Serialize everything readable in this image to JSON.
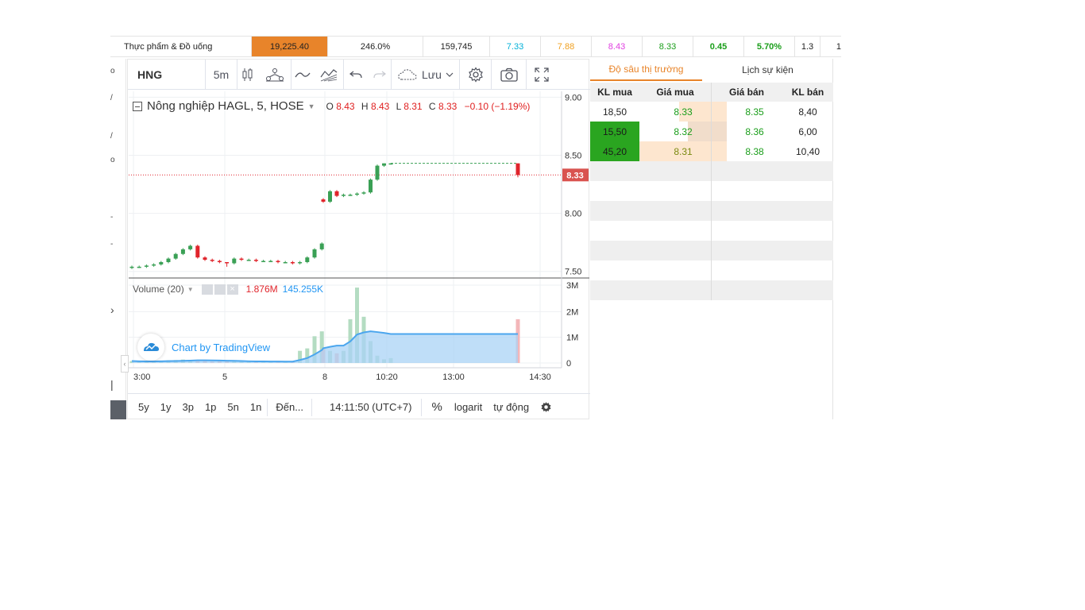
{
  "ticker": {
    "name": "Thực phẩm & Đồ uống",
    "value": "19,225.40",
    "pct": "246.0%",
    "volume": "159,745",
    "c1": "7.33",
    "c2": "7.88",
    "c3": "8.43",
    "c4": "8.33",
    "c5": "0.45",
    "c6": "5.70%",
    "c7": "1.3",
    "c8": "1",
    "colors": {
      "orange": "#e8842a",
      "cyan": "#00b0d8",
      "yellow": "#f0a020",
      "magenta": "#e040e0",
      "green": "#1a9e1a"
    }
  },
  "left_strip": {
    "glyphs": [
      "o",
      "/",
      "/",
      "o",
      "-",
      "-",
      "›",
      "|"
    ]
  },
  "toolbar": {
    "symbol": "HNG",
    "interval": "5m",
    "save_label": "Lưu",
    "icons": [
      "candles-icon",
      "indicators-icon",
      "line-style-icon",
      "compare-icon",
      "undo-icon",
      "redo-icon",
      "cloud-icon",
      "chevron-down-icon",
      "gear-icon",
      "camera-icon",
      "fullscreen-icon"
    ]
  },
  "legend": {
    "title": "Nông nghiệp HAGL, 5, HOSE",
    "o_label": "O",
    "o": "8.43",
    "h_label": "H",
    "h": "8.43",
    "l_label": "L",
    "l": "8.31",
    "c_label": "C",
    "c": "8.33",
    "change": "−0.10 (−1.19%)",
    "price_color": "#e02020"
  },
  "volume_legend": {
    "title": "Volume (20)",
    "v1": "1.876M",
    "v2": "145.255K"
  },
  "watermark": "Chart by TradingView",
  "chart_data": {
    "type": "candlestick",
    "price_axis": {
      "range": [
        7.45,
        9.05
      ],
      "ticks": [
        "9.00",
        "8.50",
        "8.00",
        "7.50"
      ]
    },
    "volume_axis": {
      "range": [
        0,
        3200000
      ],
      "ticks": [
        "3M",
        "2M",
        "1M",
        "0"
      ]
    },
    "x_ticks": [
      "3:00",
      "5",
      "8",
      "10:20",
      "13:00",
      "14:30"
    ],
    "current_price": "8.33",
    "candles": [
      {
        "t": 0,
        "o": 7.53,
        "h": 7.55,
        "l": 7.52,
        "c": 7.54
      },
      {
        "t": 1,
        "o": 7.54,
        "h": 7.55,
        "l": 7.53,
        "c": 7.54
      },
      {
        "t": 2,
        "o": 7.54,
        "h": 7.56,
        "l": 7.53,
        "c": 7.55
      },
      {
        "t": 3,
        "o": 7.55,
        "h": 7.57,
        "l": 7.54,
        "c": 7.56
      },
      {
        "t": 4,
        "o": 7.56,
        "h": 7.59,
        "l": 7.55,
        "c": 7.58
      },
      {
        "t": 5,
        "o": 7.58,
        "h": 7.62,
        "l": 7.57,
        "c": 7.61
      },
      {
        "t": 6,
        "o": 7.61,
        "h": 7.66,
        "l": 7.6,
        "c": 7.65
      },
      {
        "t": 7,
        "o": 7.65,
        "h": 7.7,
        "l": 7.64,
        "c": 7.69
      },
      {
        "t": 8,
        "o": 7.69,
        "h": 7.73,
        "l": 7.68,
        "c": 7.72
      },
      {
        "t": 9,
        "o": 7.72,
        "h": 7.73,
        "l": 7.61,
        "c": 7.62
      },
      {
        "t": 10,
        "o": 7.62,
        "h": 7.63,
        "l": 7.59,
        "c": 7.6
      },
      {
        "t": 11,
        "o": 7.6,
        "h": 7.61,
        "l": 7.58,
        "c": 7.59
      },
      {
        "t": 12,
        "o": 7.59,
        "h": 7.6,
        "l": 7.57,
        "c": 7.58
      },
      {
        "t": 13,
        "o": 7.58,
        "h": 7.58,
        "l": 7.54,
        "c": 7.57
      },
      {
        "t": 14,
        "o": 7.57,
        "h": 7.62,
        "l": 7.56,
        "c": 7.61
      },
      {
        "t": 15,
        "o": 7.61,
        "h": 7.62,
        "l": 7.59,
        "c": 7.6
      },
      {
        "t": 16,
        "o": 7.6,
        "h": 7.61,
        "l": 7.59,
        "c": 7.6
      },
      {
        "t": 17,
        "o": 7.6,
        "h": 7.61,
        "l": 7.58,
        "c": 7.59
      },
      {
        "t": 18,
        "o": 7.59,
        "h": 7.6,
        "l": 7.58,
        "c": 7.59
      },
      {
        "t": 19,
        "o": 7.59,
        "h": 7.6,
        "l": 7.58,
        "c": 7.59
      },
      {
        "t": 20,
        "o": 7.59,
        "h": 7.6,
        "l": 7.57,
        "c": 7.58
      },
      {
        "t": 21,
        "o": 7.58,
        "h": 7.59,
        "l": 7.57,
        "c": 7.58
      },
      {
        "t": 22,
        "o": 7.58,
        "h": 7.59,
        "l": 7.56,
        "c": 7.57
      },
      {
        "t": 23,
        "o": 7.57,
        "h": 7.59,
        "l": 7.56,
        "c": 7.58
      },
      {
        "t": 24,
        "o": 7.58,
        "h": 7.63,
        "l": 7.57,
        "c": 7.62
      },
      {
        "t": 25,
        "o": 7.62,
        "h": 7.7,
        "l": 7.61,
        "c": 7.69
      },
      {
        "t": 26,
        "o": 7.69,
        "h": 7.75,
        "l": 7.68,
        "c": 7.74
      },
      {
        "t": 27,
        "o": 8.12,
        "h": 8.13,
        "l": 8.09,
        "c": 8.1
      },
      {
        "t": 28,
        "o": 8.1,
        "h": 8.2,
        "l": 8.09,
        "c": 8.19
      },
      {
        "t": 29,
        "o": 8.19,
        "h": 8.2,
        "l": 8.14,
        "c": 8.15
      },
      {
        "t": 30,
        "o": 8.15,
        "h": 8.17,
        "l": 8.14,
        "c": 8.16
      },
      {
        "t": 31,
        "o": 8.16,
        "h": 8.17,
        "l": 8.15,
        "c": 8.16
      },
      {
        "t": 32,
        "o": 8.16,
        "h": 8.18,
        "l": 8.15,
        "c": 8.17
      },
      {
        "t": 33,
        "o": 8.17,
        "h": 8.19,
        "l": 8.16,
        "c": 8.18
      },
      {
        "t": 34,
        "o": 8.18,
        "h": 8.3,
        "l": 8.17,
        "c": 8.29
      },
      {
        "t": 35,
        "o": 8.29,
        "h": 8.42,
        "l": 8.28,
        "c": 8.41
      },
      {
        "t": 36,
        "o": 8.41,
        "h": 8.43,
        "l": 8.4,
        "c": 8.43
      },
      {
        "t": 37,
        "o": 8.43,
        "h": 8.43,
        "l": 8.42,
        "c": 8.43
      },
      {
        "t": 38,
        "o": 8.43,
        "h": 8.43,
        "l": 8.31,
        "c": 8.33
      }
    ],
    "volumes": [
      {
        "t": 0,
        "v": 80000,
        "up": true
      },
      {
        "t": 1,
        "v": 60000,
        "up": true
      },
      {
        "t": 2,
        "v": 50000,
        "up": true
      },
      {
        "t": 3,
        "v": 70000,
        "up": true
      },
      {
        "t": 4,
        "v": 90000,
        "up": true
      },
      {
        "t": 5,
        "v": 110000,
        "up": true
      },
      {
        "t": 6,
        "v": 120000,
        "up": true
      },
      {
        "t": 7,
        "v": 140000,
        "up": true
      },
      {
        "t": 8,
        "v": 100000,
        "up": true
      },
      {
        "t": 9,
        "v": 130000,
        "up": false
      },
      {
        "t": 10,
        "v": 90000,
        "up": false
      },
      {
        "t": 11,
        "v": 60000,
        "up": false
      },
      {
        "t": 12,
        "v": 70000,
        "up": false
      },
      {
        "t": 13,
        "v": 80000,
        "up": false
      },
      {
        "t": 14,
        "v": 90000,
        "up": true
      },
      {
        "t": 15,
        "v": 60000,
        "up": true
      },
      {
        "t": 16,
        "v": 50000,
        "up": true
      },
      {
        "t": 17,
        "v": 40000,
        "up": false
      },
      {
        "t": 18,
        "v": 60000,
        "up": true
      },
      {
        "t": 19,
        "v": 50000,
        "up": true
      },
      {
        "t": 20,
        "v": 70000,
        "up": false
      },
      {
        "t": 21,
        "v": 80000,
        "up": true
      },
      {
        "t": 22,
        "v": 60000,
        "up": false
      },
      {
        "t": 23,
        "v": 500000,
        "up": true
      },
      {
        "t": 24,
        "v": 600000,
        "up": true
      },
      {
        "t": 25,
        "v": 1100000,
        "up": true
      },
      {
        "t": 26,
        "v": 1300000,
        "up": true
      },
      {
        "t": 27,
        "v": 600000,
        "up": false
      },
      {
        "t": 28,
        "v": 500000,
        "up": true
      },
      {
        "t": 29,
        "v": 400000,
        "up": false
      },
      {
        "t": 30,
        "v": 500000,
        "up": true
      },
      {
        "t": 31,
        "v": 1800000,
        "up": true
      },
      {
        "t": 32,
        "v": 3100000,
        "up": true
      },
      {
        "t": 33,
        "v": 1900000,
        "up": true
      },
      {
        "t": 34,
        "v": 900000,
        "up": true
      },
      {
        "t": 35,
        "v": 300000,
        "up": true
      },
      {
        "t": 36,
        "v": 150000,
        "up": true
      },
      {
        "t": 37,
        "v": 200000,
        "up": true
      },
      {
        "t": 38,
        "v": 1800000,
        "up": false
      }
    ],
    "colors": {
      "up": "#3aa055",
      "down": "#e0242b",
      "vol_up": "#b4dcc2",
      "vol_down": "#f3b6b9",
      "ma_fill": "#a9d3f5",
      "ma_line": "#4ba6ee"
    }
  },
  "bottombar": {
    "ranges": [
      "5y",
      "1y",
      "3p",
      "1p",
      "5n",
      "1n"
    ],
    "goto": "Đến...",
    "time": "14:11:50 (UTC+7)",
    "percent": "%",
    "log": "logarit",
    "auto": "tự động"
  },
  "depth": {
    "tabs": [
      "Độ sâu thị trường",
      "Lịch sự kiện"
    ],
    "headers": [
      "KL mua",
      "Giá mua",
      "Giá bán",
      "KL bán"
    ],
    "rows": [
      {
        "bid_vol": "18,50",
        "bid": "8.33",
        "ask": "8.35",
        "ask_vol": "8,40",
        "bid_vol_bg": "#ffffff",
        "bid_bar": "#fde6cf",
        "bid_bar_frac": 0.55
      },
      {
        "bid_vol": "15,50",
        "bid": "8.32",
        "ask": "8.36",
        "ask_vol": "6,00",
        "bid_vol_bg": "#2aa520",
        "bid_bar": "#f1ddcb",
        "bid_bar_frac": 0.45
      },
      {
        "bid_vol": "45,20",
        "bid": "8.31",
        "ask": "8.38",
        "ask_vol": "10,40",
        "bid_vol_bg": "#2aa520",
        "bid_bar": "#fde6cf",
        "bid_bar_frac": 1.0
      }
    ],
    "colors": {
      "price_green": "#1a9e1a",
      "bid_text_dark": "#7a8a10"
    }
  }
}
